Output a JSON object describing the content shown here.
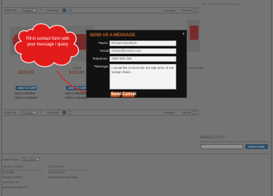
{
  "header": {
    "cart_text": "You have no items to compare."
  },
  "toolbar": {
    "sort_label": "SORT BY",
    "sort_value": "Position",
    "view_as": "VIEW AS",
    "count": "4 Item(s)",
    "show_label": "SHOW",
    "show_value": "12"
  },
  "products": [
    {
      "name": "",
      "price": "$299.99",
      "add": "ADD TO CART",
      "wishlist": "Add to Wishlist",
      "compare": "Add to Compare"
    },
    {
      "name": "CHAIR",
      "price": "$129.99",
      "add": "ADD TO CART",
      "wishlist": "Add to Wishlist",
      "compare": "Add to Compare"
    },
    {
      "name": "",
      "price": "",
      "add": "",
      "wishlist": "",
      "compare": ""
    },
    {
      "name": "FURNITURE",
      "price": "",
      "add": "",
      "wishlist": "",
      "compare": ""
    }
  ],
  "callout": {
    "text": "Fill in contact form with your message / query"
  },
  "modal": {
    "title": "SEND US A MESSAGE:",
    "close": "x",
    "fields": [
      {
        "label": "*Name:",
        "value": "Richard Davidson"
      },
      {
        "label": "*Email:",
        "value": "richard@tcomm.com"
      },
      {
        "label": "Telephone:",
        "value": "0800-900-456"
      }
    ],
    "message_label": "*Message:",
    "message_value": "I would like to know the net sale price of red lounge chairs.",
    "send": "Send",
    "cancel": "Cancel"
  },
  "newsletter": {
    "title": "NEWSLETTER",
    "button": "SUBSCRIBE"
  },
  "footer": {
    "store_label": "Select Store:",
    "store_value": "Main Store",
    "col1_title": "QUICK LINKS",
    "col1_links": [
      "SITE MAP",
      "SEARCH TERMS",
      "CONTACT US",
      "ADVANCED SEARCH"
    ],
    "col2_title": "ACCOUNT",
    "col2_links": [
      "MY ACCOUNT",
      "ORDERS AND RETURNS"
    ]
  },
  "colors": {
    "accent": "#c9561e",
    "callout_red": "#e31b1b",
    "link_blue": "#2c4e66"
  }
}
